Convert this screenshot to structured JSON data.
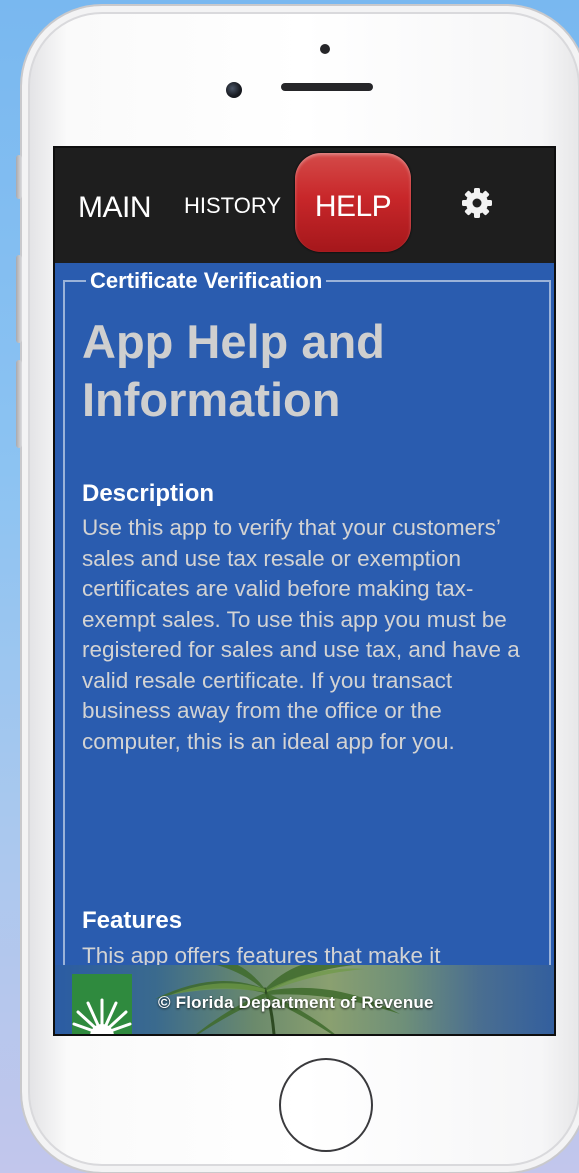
{
  "colors": {
    "navbar": "#1e1e1e",
    "active_tab": "#c8272a",
    "content_background": "#2a5caf",
    "title_text": "#cfcfcf",
    "body_text": "#d3d3d3",
    "logo_green": "#2f8a3e"
  },
  "nav": {
    "main_label": "MAIN",
    "history_label": "HISTORY",
    "help_label": "HELP",
    "settings_icon": "gear-icon",
    "active_tab": "HELP"
  },
  "help": {
    "legend": "Certificate Verification",
    "title": "App Help and Information",
    "description_heading": "Description",
    "description_body": "Use this app to verify that your customers’ sales and use tax resale or exemption certificates are valid before making tax-exempt sales. To use this app you must be registered for sales and use tax, and have a valid resale certificate. If you transact business away from the office or the computer, this is an ideal app for you.",
    "features_heading": "Features",
    "features_body": "This app offers features that make it"
  },
  "footer": {
    "logo_icon": "sunburst-logo-icon",
    "banner_image": "palm-tree-banner",
    "copyright_text": "© Florida Department of Revenue"
  },
  "device": {
    "home_button_icon": "home-button-ring",
    "camera_icon": "front-camera-icon"
  }
}
